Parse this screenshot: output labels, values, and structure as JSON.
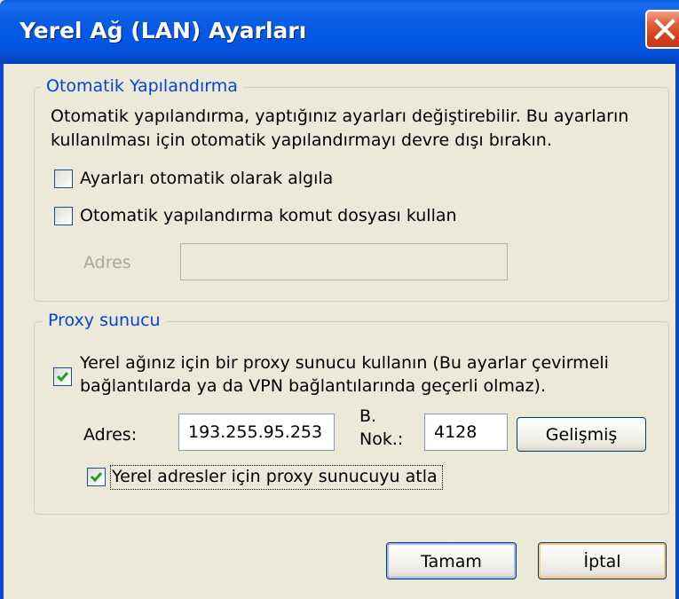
{
  "window": {
    "title": "Yerel Ağ (LAN) Ayarları",
    "close_icon": "close-icon",
    "title_color": "#0058e6"
  },
  "auto_config": {
    "group_title": "Otomatik Yapılandırma",
    "description_line1": "Otomatik yapılandırma, yaptığınız ayarları değiştirebilir. Bu ayarların",
    "description_line2": "kullanılması için otomatik yapılandırmayı devre dışı bırakın.",
    "detect_checkbox": {
      "label": "Ayarları otomatik olarak algıla",
      "checked": false
    },
    "script_checkbox": {
      "label": "Otomatik yapılandırma komut dosyası kullan",
      "checked": false
    },
    "address_label": "Adres",
    "address_value": ""
  },
  "proxy": {
    "group_title": "Proxy sunucu",
    "use_proxy_checkbox": {
      "label_line1": "Yerel ağınız için bir proxy sunucu kullanın (Bu ayarlar çevirmeli",
      "label_line2": "bağlantılarda ya da VPN bağlantılarında geçerli olmaz).",
      "checked": true
    },
    "address_label": "Adres:",
    "address_value": "193.255.95.253",
    "port_label_line1": "B.",
    "port_label_line2": "Nok.:",
    "port_value": "4128",
    "advanced_button": "Gelişmiş",
    "bypass_checkbox": {
      "label": "Yerel adresler için proxy sunucuyu atla",
      "checked": true
    }
  },
  "buttons": {
    "ok": "Tamam",
    "cancel": "İptal"
  },
  "colors": {
    "group_title": "#0046d5",
    "check_mark": "#21a121",
    "dialog_bg": "#ece9d8"
  }
}
